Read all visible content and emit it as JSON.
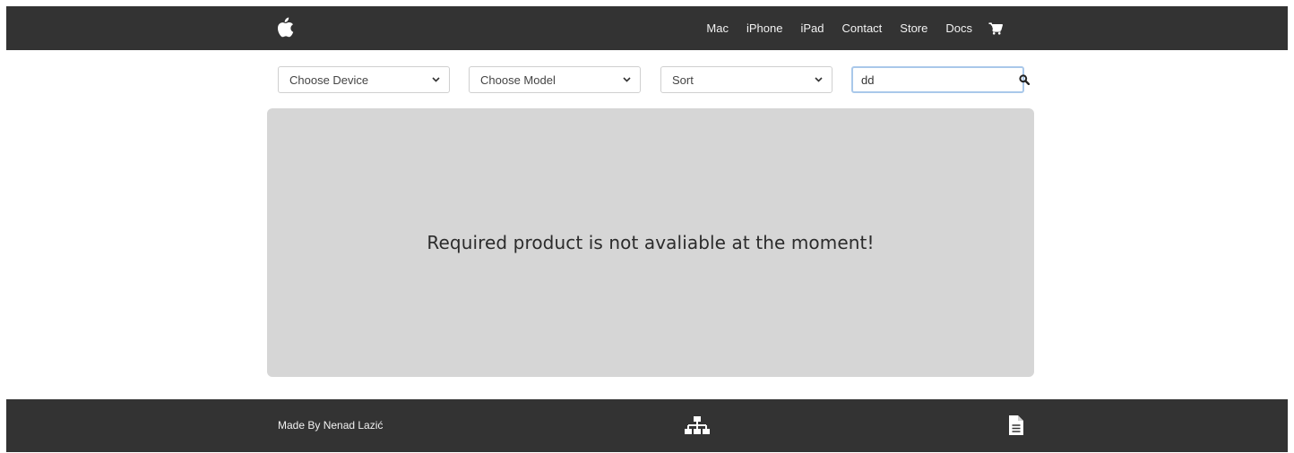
{
  "navbar": {
    "logo_icon": "apple-logo-icon",
    "links": [
      {
        "label": "Mac"
      },
      {
        "label": "iPhone"
      },
      {
        "label": "iPad"
      },
      {
        "label": "Contact"
      },
      {
        "label": "Store"
      },
      {
        "label": "Docs"
      }
    ],
    "cart_icon": "shopping-cart-icon"
  },
  "filters": {
    "device": {
      "selected": "Choose Device"
    },
    "model": {
      "selected": "Choose Model"
    },
    "sort": {
      "selected": "Sort"
    },
    "search": {
      "value": "dd",
      "icon": "search-icon"
    }
  },
  "main": {
    "message": "Required product is not avaliable at the moment!"
  },
  "footer": {
    "credit": "Made By Nenad Lazić",
    "sitemap_icon": "sitemap-icon",
    "document_icon": "document-icon"
  },
  "colors": {
    "navbar_bg": "#333333",
    "panel_bg": "#d6d6d6",
    "search_focus_border": "#a9c8ea"
  }
}
